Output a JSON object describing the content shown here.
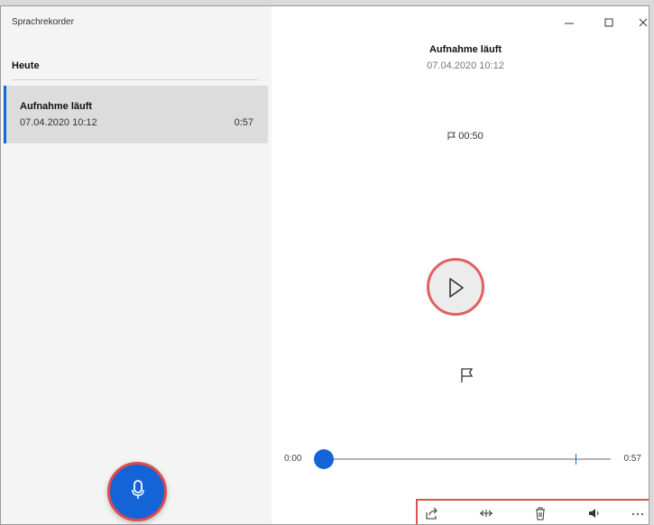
{
  "app": {
    "title": "Sprachrekorder"
  },
  "sidebar": {
    "section_header": "Heute",
    "recordings": [
      {
        "title": "Aufnahme läuft",
        "date": "07.04.2020 10:12",
        "duration": "0:57"
      }
    ],
    "record_button_icon": "microphone-icon"
  },
  "main": {
    "title": "Aufnahme läuft",
    "date": "07.04.2020 10:12",
    "marker_time": "00:50",
    "play_icon": "play-icon",
    "add_marker_icon": "flag-icon"
  },
  "player": {
    "time_start": "0:00",
    "time_end": "0:57",
    "progress": 0,
    "marker_fraction": 0.877
  },
  "toolbar": {
    "items": [
      "share-icon",
      "trim-icon",
      "delete-icon",
      "volume-icon",
      "more-icon"
    ]
  },
  "colors": {
    "accent": "#1464d8",
    "highlight": "#e05252",
    "sidebar_bg": "#f4f4f4",
    "selected_item_bg": "#dcdcdc"
  }
}
